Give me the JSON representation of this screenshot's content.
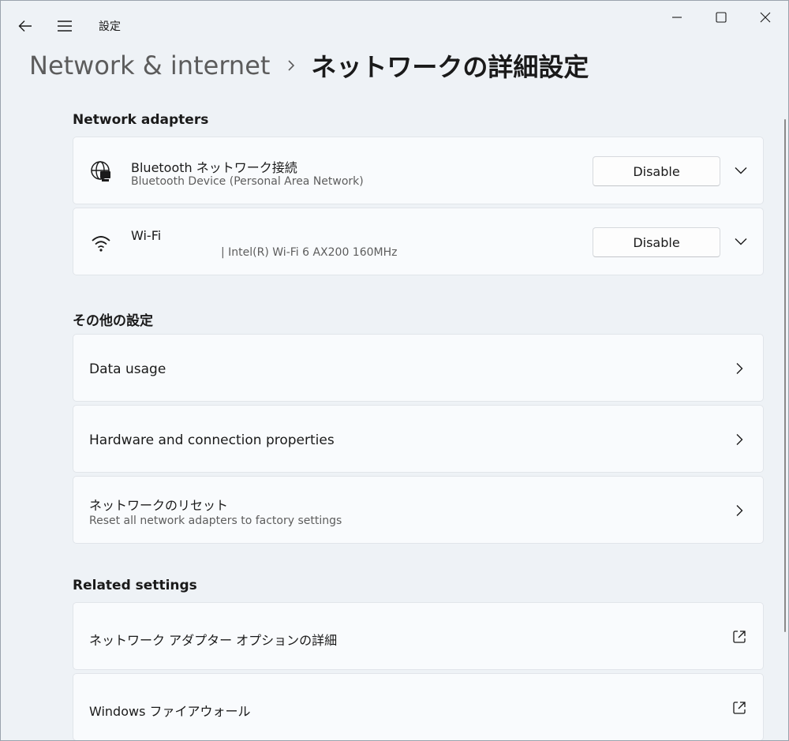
{
  "titlebar": {
    "app_title": "設定"
  },
  "breadcrumb": {
    "parent": "Network & internet",
    "current": "ネットワークの詳細設定"
  },
  "network_adapters": {
    "heading": "Network adapters",
    "items": [
      {
        "name": "Bluetooth ネットワーク接続",
        "description": "Bluetooth Device (Personal Area Network)",
        "button": "Disable",
        "icon": "globe-network-icon"
      },
      {
        "name": "Wi-Fi",
        "description": "| Intel(R) Wi-Fi 6 AX200 160MHz",
        "button": "Disable",
        "icon": "wifi-icon"
      }
    ]
  },
  "more_settings": {
    "heading": "その他の設定",
    "items": [
      {
        "title": "Data usage"
      },
      {
        "title": "Hardware and connection properties"
      },
      {
        "title": "ネットワークのリセット",
        "description": "Reset all network adapters to factory settings"
      }
    ]
  },
  "related_settings": {
    "heading": "Related settings",
    "items": [
      {
        "title": "ネットワーク アダプター オプションの詳細"
      },
      {
        "title": "Windows ファイアウォール"
      }
    ]
  }
}
